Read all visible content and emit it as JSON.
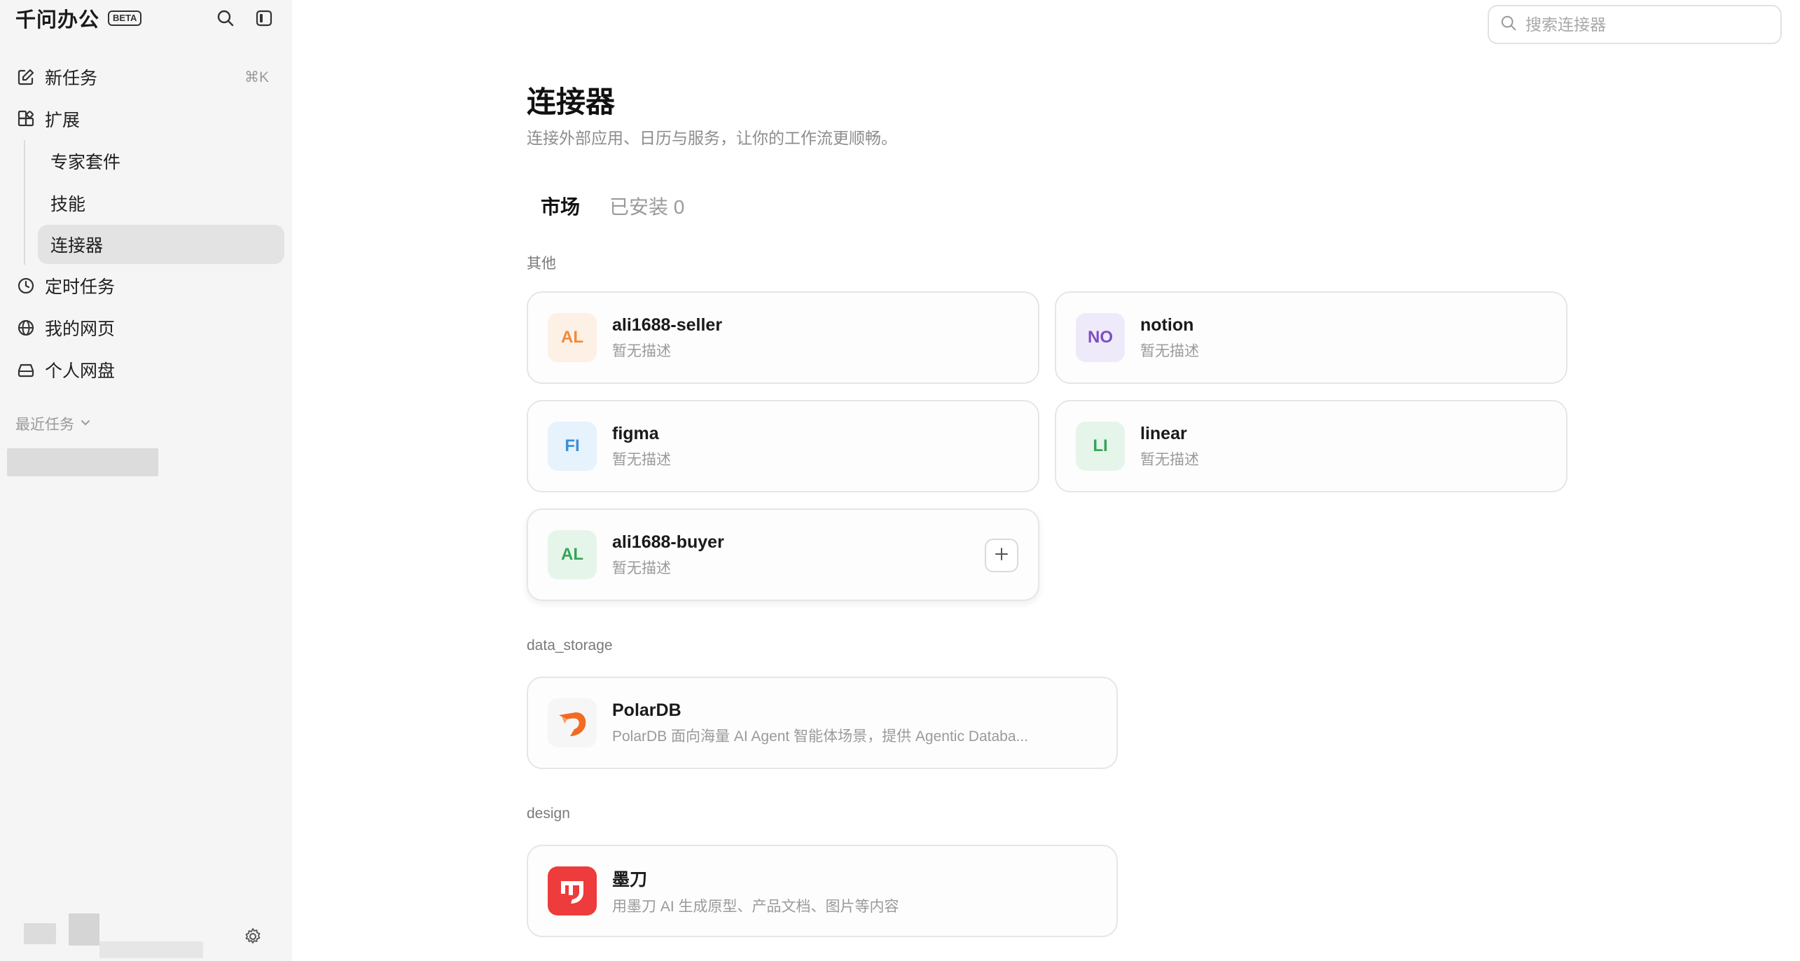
{
  "app": {
    "name": "千问办公",
    "badge": "BETA"
  },
  "sidebar": {
    "new_task": {
      "label": "新任务",
      "shortcut": "⌘K"
    },
    "extensions": {
      "label": "扩展"
    },
    "sub_items": [
      {
        "label": "专家套件"
      },
      {
        "label": "技能"
      },
      {
        "label": "连接器"
      }
    ],
    "scheduled": {
      "label": "定时任务"
    },
    "my_pages": {
      "label": "我的网页"
    },
    "drive": {
      "label": "个人网盘"
    },
    "recent": {
      "label": "最近任务"
    }
  },
  "search": {
    "placeholder": "搜索连接器"
  },
  "page": {
    "title": "连接器",
    "subtitle": "连接外部应用、日历与服务，让你的工作流更顺畅。"
  },
  "tabs": [
    {
      "label": "市场",
      "active": true
    },
    {
      "label": "已安装 0",
      "active": false
    }
  ],
  "sections": [
    {
      "label": "其他",
      "cards": [
        {
          "initials": "AL",
          "name": "ali1688-seller",
          "desc": "暂无描述",
          "bg": "#fdf0e4",
          "fg": "#f08a3c"
        },
        {
          "initials": "NO",
          "name": "notion",
          "desc": "暂无描述",
          "bg": "#efeafa",
          "fg": "#7b4fc4"
        },
        {
          "initials": "FI",
          "name": "figma",
          "desc": "暂无描述",
          "bg": "#e6f2fc",
          "fg": "#3a8fd6"
        },
        {
          "initials": "LI",
          "name": "linear",
          "desc": "暂无描述",
          "bg": "#e6f5ea",
          "fg": "#33a557"
        },
        {
          "initials": "AL",
          "name": "ali1688-buyer",
          "desc": "暂无描述",
          "bg": "#e6f5ea",
          "fg": "#33a557"
        }
      ]
    },
    {
      "label": "data_storage",
      "cards": [
        {
          "name": "PolarDB",
          "desc": "PolarDB 面向海量 AI Agent 智能体场景，提供 Agentic Databa...",
          "icon": "polardb-logo"
        }
      ]
    },
    {
      "label": "design",
      "cards": [
        {
          "name": "墨刀",
          "desc": "用墨刀 AI 生成原型、产品文档、图片等内容",
          "icon": "modao-logo"
        }
      ]
    }
  ],
  "colors": {
    "sidebar_bg": "#f5f5f5",
    "active_item_bg": "#e3e3e3",
    "modao_red": "#ee3b3b",
    "polardb_orange": "#f26b22"
  }
}
